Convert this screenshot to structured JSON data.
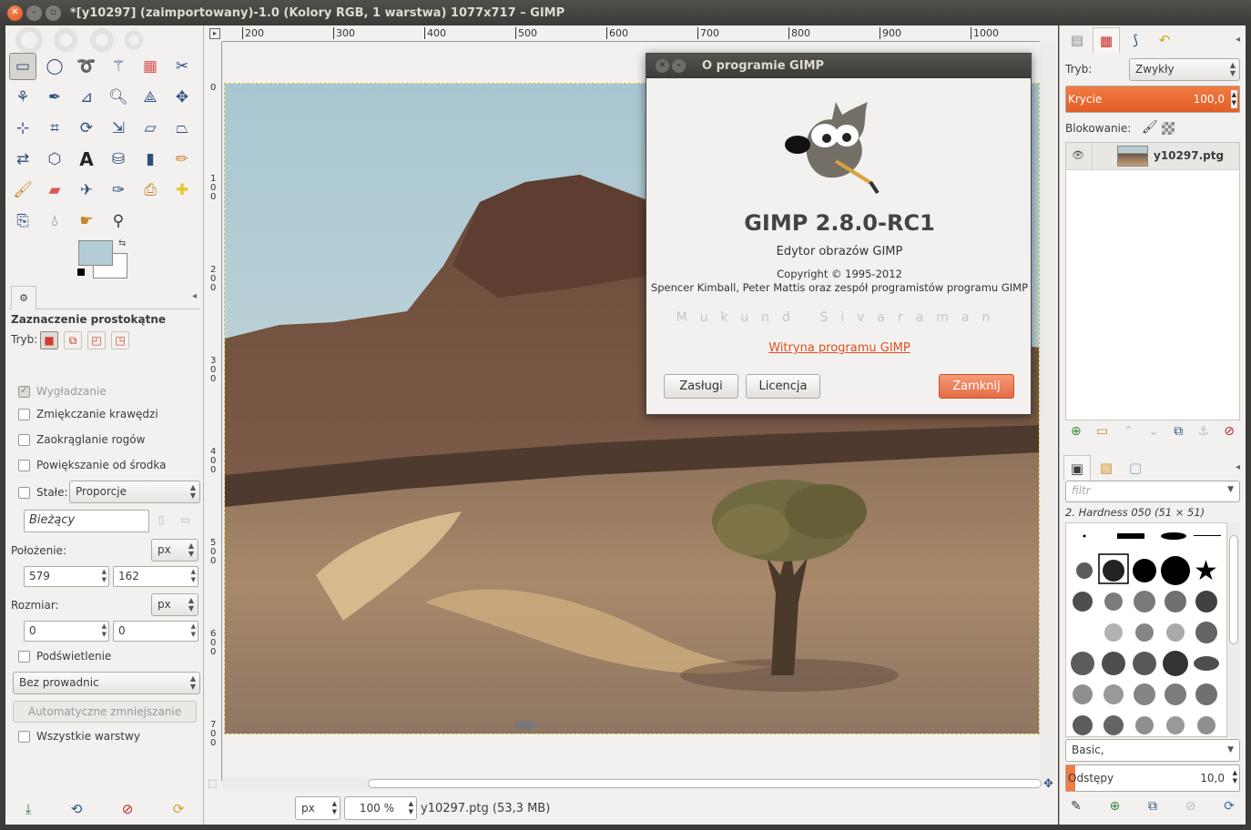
{
  "window": {
    "title": "*[y10297] (zaimportowany)-1.0 (Kolory RGB, 1 warstwa) 1077x717 – GIMP"
  },
  "toolbox": {
    "tools": [
      "rect-select",
      "ellipse-select",
      "free-select",
      "fuzzy-select",
      "select-by-color",
      "scissors",
      "foreground-select",
      "paths",
      "color-picker",
      "zoom",
      "measure",
      "move",
      "align",
      "crop",
      "rotate",
      "scale",
      "shear",
      "perspective",
      "flip",
      "cage",
      "text",
      "bucket-fill",
      "blend",
      "pencil",
      "paintbrush",
      "eraser",
      "airbrush",
      "ink",
      "clone",
      "heal",
      "perspective-clone",
      "blur",
      "smudge",
      "dodge-burn"
    ],
    "fg_color": "#b4ccd6",
    "bg_color": "#ffffff"
  },
  "tool_options": {
    "title": "Zaznaczenie prostokątne",
    "mode_label": "Tryb:",
    "antialias": "Wygładzanie",
    "feather": "Zmiękczanie krawędzi",
    "rounded": "Zaokrąglanie rogów",
    "expand_center": "Powiększanie od środka",
    "fixed_label": "Stałe:",
    "fixed_value": "Proporcje",
    "ratio_value": "Bieżący",
    "position_label": "Położenie:",
    "position_unit": "px",
    "pos_x": "579",
    "pos_y": "162",
    "size_label": "Rozmiar:",
    "size_unit": "px",
    "size_w": "0",
    "size_h": "0",
    "highlight": "Podświetlenie",
    "guides": "Bez prowadnic",
    "auto_shrink": "Automatyczne zmniejszanie",
    "all_layers": "Wszystkie warstwy"
  },
  "ruler": {
    "h_ticks": [
      "200",
      "300",
      "400",
      "500",
      "600",
      "700",
      "800",
      "900",
      "1000"
    ],
    "v_ticks": [
      "0",
      "100",
      "200",
      "300",
      "400",
      "500",
      "600",
      "700"
    ]
  },
  "status": {
    "unit": "px",
    "zoom": "100 %",
    "file_info": "y10297.ptg (53,3 MB)"
  },
  "about": {
    "title": "O programie GIMP",
    "app_name": "GIMP 2.8.0-RC1",
    "description": "Edytor obrazów GIMP",
    "copyright": "Copyright © 1995-2012",
    "authors": "Spencer Kimball, Peter Mattis oraz zespół programistów programu GIMP",
    "translator": "Mukund Sivaraman",
    "website": "Witryna programu GIMP",
    "credits_btn": "Zasługi",
    "license_btn": "Licencja",
    "close_btn": "Zamknij"
  },
  "layers": {
    "mode_label": "Tryb:",
    "mode_value": "Zwykły",
    "opacity_label": "Krycie",
    "opacity_value": "100,0",
    "lock_label": "Blokowanie:",
    "layer_name": "y10297.ptg"
  },
  "brushes": {
    "filter_placeholder": "filtr",
    "current_brush": "2. Hardness 050 (51 × 51)",
    "preset": "Basic,",
    "spacing_label": "Odstępy",
    "spacing_value": "10,0"
  },
  "colors": {
    "accent": "#e35e25",
    "titlebar": "#3c3b37",
    "panel": "#f2f1f0"
  }
}
